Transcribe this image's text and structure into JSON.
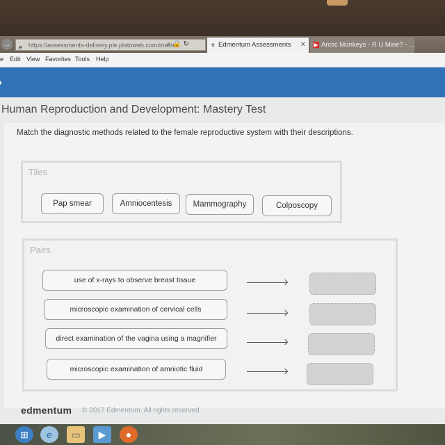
{
  "browser": {
    "address": "https://assessments-delivery.ple.platoweb.com/masten",
    "tabs": [
      {
        "label": "Edmentum Assessments",
        "active": true
      },
      {
        "label": "Arctic Monkeys - R U Mine? - ...",
        "active": false
      }
    ],
    "menu": [
      "e",
      "Edit",
      "View",
      "Favorites",
      "Tools",
      "Help"
    ]
  },
  "page": {
    "title": "Human Reproduction and Development: Mastery Test",
    "prompt": "Match the diagnostic methods related to the female reproductive system with their descriptions."
  },
  "tiles": {
    "label": "Tiles",
    "items": [
      "Pap smear",
      "Amniocentesis",
      "Mammography",
      "Colposcopy"
    ]
  },
  "pairs": {
    "label": "Pairs",
    "items": [
      {
        "description": "use of x-rays to observe breast tissue",
        "answer": ""
      },
      {
        "description": "microscopic examination of cervical cells",
        "answer": ""
      },
      {
        "description": "direct examination of the vagina using a magnifier",
        "answer": ""
      },
      {
        "description": "microscopic examination of amniotic fluid",
        "answer": ""
      }
    ]
  },
  "footer": {
    "logo": "edmentum",
    "copyright": "© 2017 Edmentum. All rights reserved."
  },
  "colors": {
    "brand_blue": "#2f72b8"
  }
}
